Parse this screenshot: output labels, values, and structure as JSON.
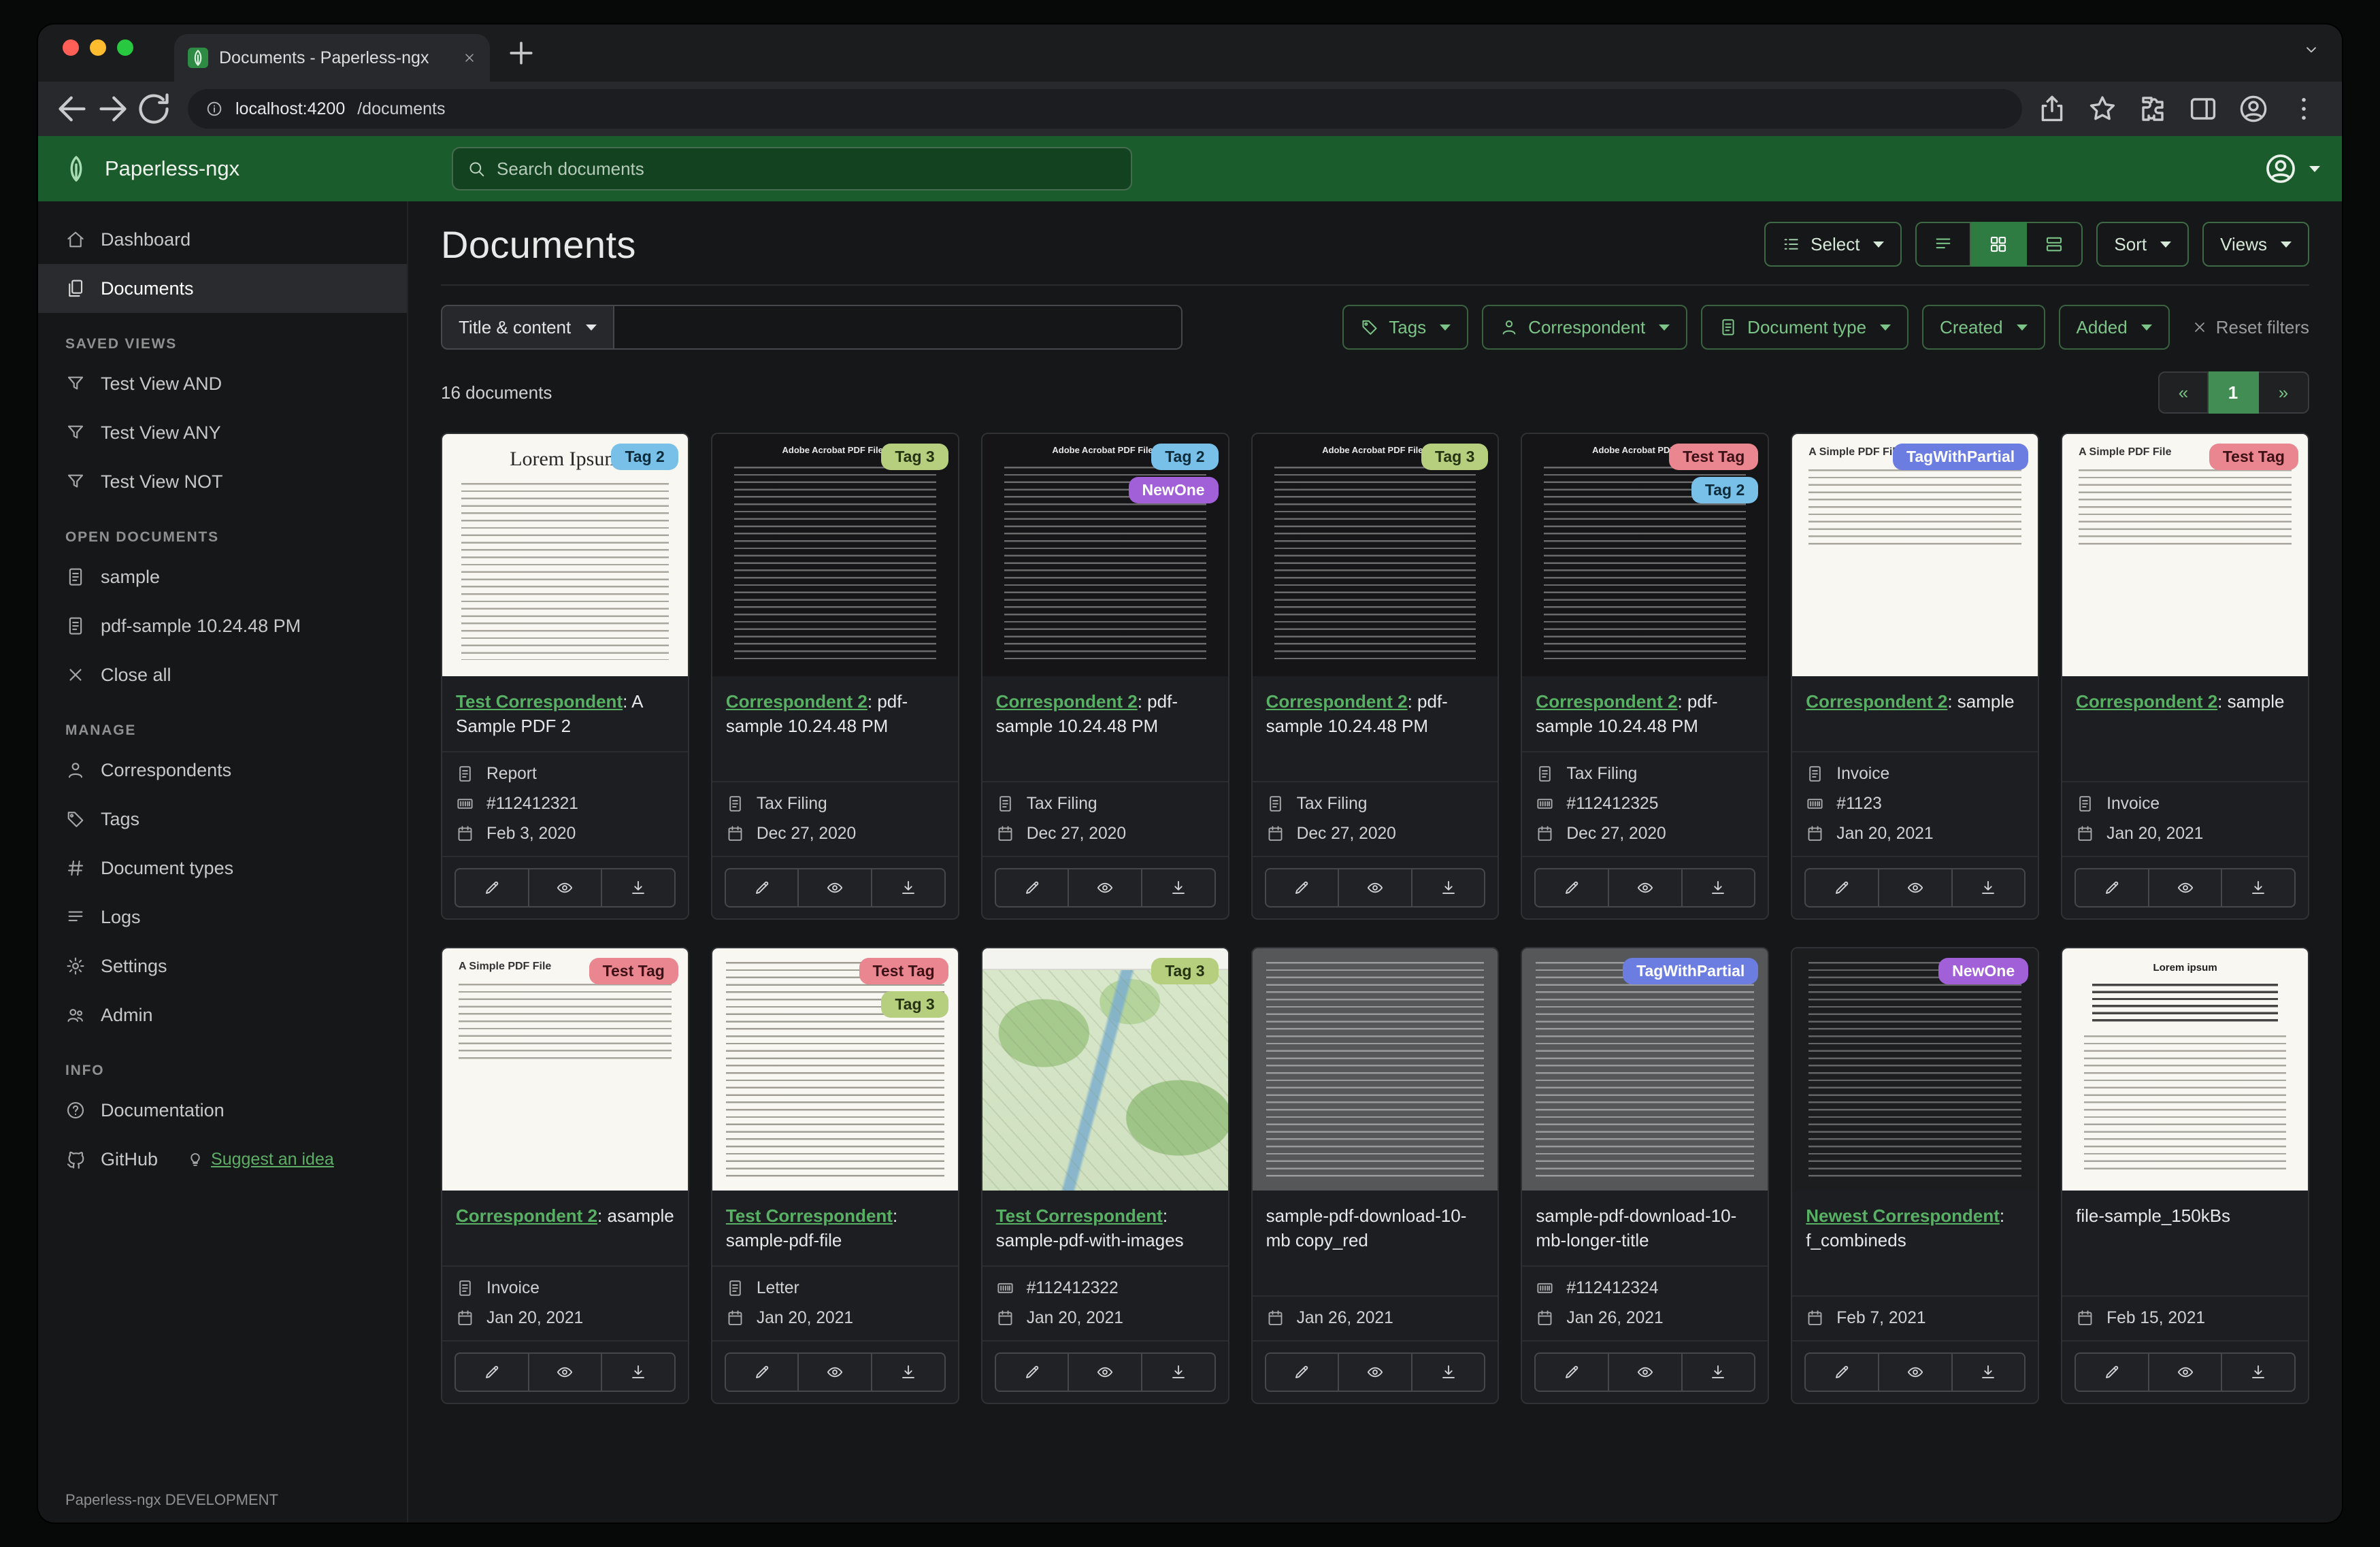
{
  "browser": {
    "tab_title": "Documents - Paperless-ngx",
    "url_host": "localhost:4200",
    "url_path": "/documents"
  },
  "header": {
    "brand": "Paperless-ngx",
    "search_placeholder": "Search documents"
  },
  "sidebar": {
    "primary": [
      {
        "label": "Dashboard",
        "icon": "house",
        "active": false
      },
      {
        "label": "Documents",
        "icon": "files",
        "active": true
      }
    ],
    "sections": [
      {
        "title": "SAVED VIEWS",
        "items": [
          {
            "label": "Test View AND",
            "icon": "funnel"
          },
          {
            "label": "Test View ANY",
            "icon": "funnel"
          },
          {
            "label": "Test View NOT",
            "icon": "funnel"
          }
        ]
      },
      {
        "title": "OPEN DOCUMENTS",
        "items": [
          {
            "label": "sample",
            "icon": "doc"
          },
          {
            "label": "pdf-sample 10.24.48 PM",
            "icon": "doc"
          },
          {
            "label": "Close all",
            "icon": "close"
          }
        ]
      },
      {
        "title": "MANAGE",
        "items": [
          {
            "label": "Correspondents",
            "icon": "person"
          },
          {
            "label": "Tags",
            "icon": "tag"
          },
          {
            "label": "Document types",
            "icon": "hash"
          },
          {
            "label": "Logs",
            "icon": "listul"
          },
          {
            "label": "Settings",
            "icon": "gear"
          },
          {
            "label": "Admin",
            "icon": "people"
          }
        ]
      },
      {
        "title": "INFO",
        "items": [
          {
            "label": "Documentation",
            "icon": "question"
          },
          {
            "label": "GitHub",
            "icon": "github",
            "extra": {
              "label": "Suggest an idea",
              "icon": "bulb"
            }
          }
        ]
      }
    ],
    "footer": "Paperless-ngx DEVELOPMENT"
  },
  "main": {
    "title": "Documents",
    "select_label": "Select",
    "sort_label": "Sort",
    "views_label": "Views",
    "filter_field_label": "Title & content",
    "filter_buttons": [
      {
        "label": "Tags",
        "icon": "tag"
      },
      {
        "label": "Correspondent",
        "icon": "person"
      },
      {
        "label": "Document type",
        "icon": "doc"
      },
      {
        "label": "Created",
        "icon": ""
      },
      {
        "label": "Added",
        "icon": ""
      }
    ],
    "reset_label": "Reset filters",
    "count_text": "16 documents",
    "pagination": {
      "prev": "«",
      "page": "1",
      "next": "»"
    }
  },
  "tag_colors": {
    "Tag 2": {
      "bg": "#79c0e8",
      "fg": "#0d2b3a"
    },
    "Tag 3": {
      "bg": "#b6cf7f",
      "fg": "#263312"
    },
    "NewOne": {
      "bg": "#a15fd8",
      "fg": "#ffffff"
    },
    "Test Tag": {
      "bg": "#ea868f",
      "fg": "#3d1216"
    },
    "TagWithPartial": {
      "bg": "#6b7de0",
      "fg": "#ffffff"
    }
  },
  "documents": [
    {
      "thumb": {
        "variant": "lorem",
        "heading": "Lorem Ipsum"
      },
      "tags": [
        "Tag 2"
      ],
      "title_link": "Test Correspondent",
      "title_rest": ": A Sample PDF 2",
      "meta": [
        {
          "icon": "doc",
          "text": "Report"
        },
        {
          "icon": "asn",
          "text": "#112412321"
        },
        {
          "icon": "calendar",
          "text": "Feb 3, 2020"
        }
      ]
    },
    {
      "thumb": {
        "variant": "adobe",
        "heading": "Adobe Acrobat PDF Files"
      },
      "tags": [
        "Tag 3"
      ],
      "title_link": "Correspondent 2",
      "title_rest": ": pdf-sample 10.24.48 PM",
      "meta": [
        {
          "icon": "doc",
          "text": "Tax Filing"
        },
        {
          "icon": "calendar",
          "text": "Dec 27, 2020"
        }
      ]
    },
    {
      "thumb": {
        "variant": "adobe",
        "heading": "Adobe Acrobat PDF Files"
      },
      "tags": [
        "Tag 2",
        "NewOne"
      ],
      "title_link": "Correspondent 2",
      "title_rest": ": pdf-sample 10.24.48 PM",
      "meta": [
        {
          "icon": "doc",
          "text": "Tax Filing"
        },
        {
          "icon": "calendar",
          "text": "Dec 27, 2020"
        }
      ]
    },
    {
      "thumb": {
        "variant": "adobe",
        "heading": "Adobe Acrobat PDF Files"
      },
      "tags": [
        "Tag 3"
      ],
      "title_link": "Correspondent 2",
      "title_rest": ": pdf-sample 10.24.48 PM",
      "meta": [
        {
          "icon": "doc",
          "text": "Tax Filing"
        },
        {
          "icon": "calendar",
          "text": "Dec 27, 2020"
        }
      ]
    },
    {
      "thumb": {
        "variant": "adobe",
        "heading": "Adobe Acrobat PDF Files"
      },
      "tags": [
        "Test Tag",
        "Tag 2"
      ],
      "title_link": "Correspondent 2",
      "title_rest": ": pdf-sample 10.24.48 PM",
      "meta": [
        {
          "icon": "doc",
          "text": "Tax Filing"
        },
        {
          "icon": "asn",
          "text": "#112412325"
        },
        {
          "icon": "calendar",
          "text": "Dec 27, 2020"
        }
      ]
    },
    {
      "thumb": {
        "variant": "simple",
        "heading": "A Simple PDF File"
      },
      "tags": [
        "TagWithPartial"
      ],
      "title_link": "Correspondent 2",
      "title_rest": ": sample",
      "meta": [
        {
          "icon": "doc",
          "text": "Invoice"
        },
        {
          "icon": "asn",
          "text": "#1123"
        },
        {
          "icon": "calendar",
          "text": "Jan 20, 2021"
        }
      ]
    },
    {
      "thumb": {
        "variant": "simple",
        "heading": "A Simple PDF File"
      },
      "tags": [
        "Test Tag"
      ],
      "title_link": "Correspondent 2",
      "title_rest": ": sample",
      "meta": [
        {
          "icon": "doc",
          "text": "Invoice"
        },
        {
          "icon": "calendar",
          "text": "Jan 20, 2021"
        }
      ]
    },
    {
      "thumb": {
        "variant": "simple",
        "heading": "A Simple PDF File"
      },
      "tags": [
        "Test Tag"
      ],
      "title_link": "Correspondent 2",
      "title_rest": ": asample",
      "meta": [
        {
          "icon": "doc",
          "text": "Invoice"
        },
        {
          "icon": "calendar",
          "text": "Jan 20, 2021"
        }
      ]
    },
    {
      "thumb": {
        "variant": "dense",
        "heading": ""
      },
      "tags": [
        "Test Tag",
        "Tag 3"
      ],
      "title_link": "Test Correspondent",
      "title_rest": ": sample-pdf-file",
      "meta": [
        {
          "icon": "doc",
          "text": "Letter"
        },
        {
          "icon": "calendar",
          "text": "Jan 20, 2021"
        }
      ]
    },
    {
      "thumb": {
        "variant": "map",
        "heading": ""
      },
      "tags": [
        "Tag 3"
      ],
      "title_link": "Test Correspondent",
      "title_rest": ": sample-pdf-with-images",
      "meta": [
        {
          "icon": "asn",
          "text": "#112412322"
        },
        {
          "icon": "calendar",
          "text": "Jan 20, 2021"
        }
      ]
    },
    {
      "thumb": {
        "variant": "gray",
        "heading": ""
      },
      "tags": [],
      "title_link": "",
      "title_rest": "sample-pdf-download-10-mb copy_red",
      "meta": [
        {
          "icon": "calendar",
          "text": "Jan 26, 2021"
        }
      ]
    },
    {
      "thumb": {
        "variant": "gray",
        "heading": ""
      },
      "tags": [
        "TagWithPartial"
      ],
      "title_link": "",
      "title_rest": "sample-pdf-download-10-mb-longer-title",
      "meta": [
        {
          "icon": "asn",
          "text": "#112412324"
        },
        {
          "icon": "calendar",
          "text": "Jan 26, 2021"
        }
      ]
    },
    {
      "thumb": {
        "variant": "darkdense",
        "heading": ""
      },
      "tags": [
        "NewOne"
      ],
      "title_link": "Newest Correspondent",
      "title_rest": ": f_combineds",
      "meta": [
        {
          "icon": "calendar",
          "text": "Feb 7, 2021"
        }
      ]
    },
    {
      "thumb": {
        "variant": "filesample",
        "heading": "Lorem ipsum"
      },
      "tags": [],
      "title_link": "",
      "title_rest": "file-sample_150kBs",
      "meta": [
        {
          "icon": "calendar",
          "text": "Feb 15, 2021"
        }
      ]
    }
  ]
}
